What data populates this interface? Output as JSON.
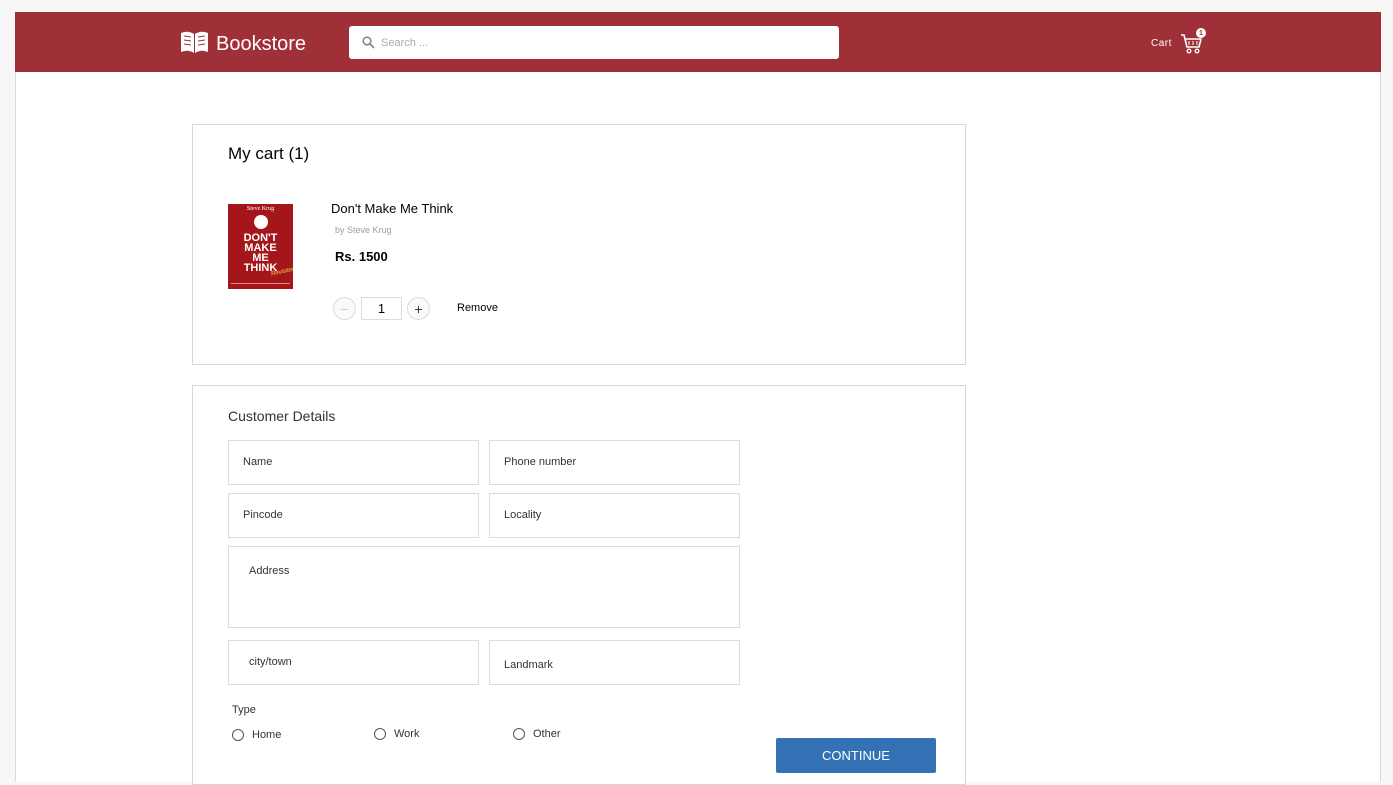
{
  "header": {
    "brand": "Bookstore",
    "search_placeholder": "Search ...",
    "cart_label": "Cart",
    "cart_count": "1",
    "accent_color": "#A03037"
  },
  "cart": {
    "title": "My cart (1)",
    "item": {
      "cover_author": "Steve Krug",
      "cover_line1": "DON'T",
      "cover_line2": "MAKE",
      "cover_line3": "ME",
      "cover_line4": "THINK",
      "cover_revisited": "Revisited",
      "title": "Don't Make Me Think",
      "author": "by Steve Krug",
      "price": "Rs. 1500",
      "quantity": "1",
      "minus": "−",
      "plus": "+",
      "remove_label": "Remove"
    }
  },
  "customer": {
    "title": "Customer Details",
    "fields": {
      "name": "Name",
      "phone": "Phone number",
      "pincode": "Pincode",
      "locality": "Locality",
      "address": "Address",
      "city": "city/town",
      "landmark": "Landmark"
    },
    "type_label": "Type",
    "types": [
      "Home",
      "Work",
      "Other"
    ],
    "continue_label": "CONTINUE",
    "button_color": "#3371B5"
  }
}
